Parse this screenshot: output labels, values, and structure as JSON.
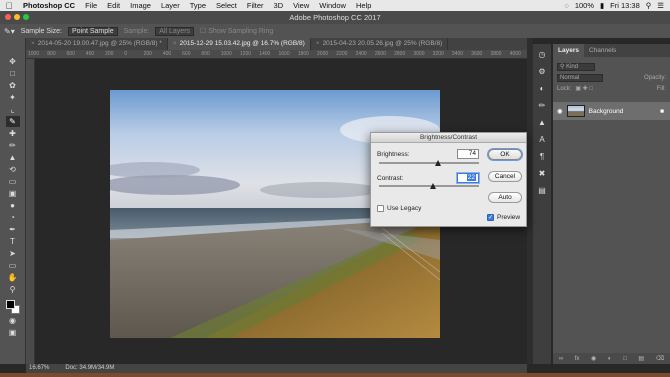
{
  "menubar": {
    "app": "Photoshop CC",
    "items": [
      "File",
      "Edit",
      "Image",
      "Layer",
      "Type",
      "Select",
      "Filter",
      "3D",
      "View",
      "Window",
      "Help"
    ],
    "battery": "100%",
    "clock": "Fri 13:38"
  },
  "window_title": "Adobe Photoshop CC 2017",
  "options_bar": {
    "sample_size_label": "Sample Size:",
    "sample_size_value": "Point Sample",
    "sample_label": "Sample:",
    "sample_value": "All Layers",
    "show_ring": "Show Sampling Ring"
  },
  "doc_tabs": [
    {
      "label": "2014-05-20 19.00.47.jpg @ 25% (RGB/8) *",
      "active": false
    },
    {
      "label": "2015-12-29 15.03.42.jpg @ 16.7% (RGB/8)",
      "active": true
    },
    {
      "label": "2015-04-23 20.05.26.jpg @ 25% (RGB/8)",
      "active": false
    }
  ],
  "ruler_ticks": [
    "1000",
    "800",
    "600",
    "400",
    "200",
    "0",
    "200",
    "400",
    "600",
    "800",
    "1000",
    "1200",
    "1400",
    "1600",
    "1800",
    "2000",
    "2200",
    "2400",
    "2600",
    "2800",
    "3000",
    "3200",
    "3400",
    "3600",
    "3800",
    "4000"
  ],
  "status": {
    "zoom": "16.67%",
    "doc": "Doc: 34.9M/34.9M"
  },
  "layers_panel": {
    "tabs": [
      "Layers",
      "Channels"
    ],
    "kind_placeholder": "Kind",
    "blend_mode": "Normal",
    "opacity_label": "Opacity:",
    "lock_label": "Lock:",
    "fill_label": "Fill:",
    "layer_name": "Background"
  },
  "dialog": {
    "title": "Brightness/Contrast",
    "brightness_label": "Brightness:",
    "brightness_value": "74",
    "brightness_level": 0.59,
    "contrast_label": "Contrast:",
    "contrast_value": "22",
    "contrast_level": 0.54,
    "use_legacy_label": "Use Legacy",
    "use_legacy_checked": false,
    "ok_label": "OK",
    "cancel_label": "Cancel",
    "auto_label": "Auto",
    "preview_label": "Preview",
    "preview_checked": true
  },
  "icons": {
    "tools": [
      "move-icon",
      "marquee-icon",
      "lasso-icon",
      "quick-select-icon",
      "crop-icon",
      "eyedropper-icon",
      "healing-icon",
      "brush-icon",
      "stamp-icon",
      "history-brush-icon",
      "eraser-icon",
      "gradient-icon",
      "blur-icon",
      "dodge-icon",
      "pen-icon",
      "type-icon",
      "path-select-icon",
      "shape-icon",
      "hand-icon",
      "zoom-icon"
    ]
  },
  "colors": {
    "accent": "#3b7bdb",
    "ui_bg": "#535353",
    "canvas_bg": "#282828"
  }
}
